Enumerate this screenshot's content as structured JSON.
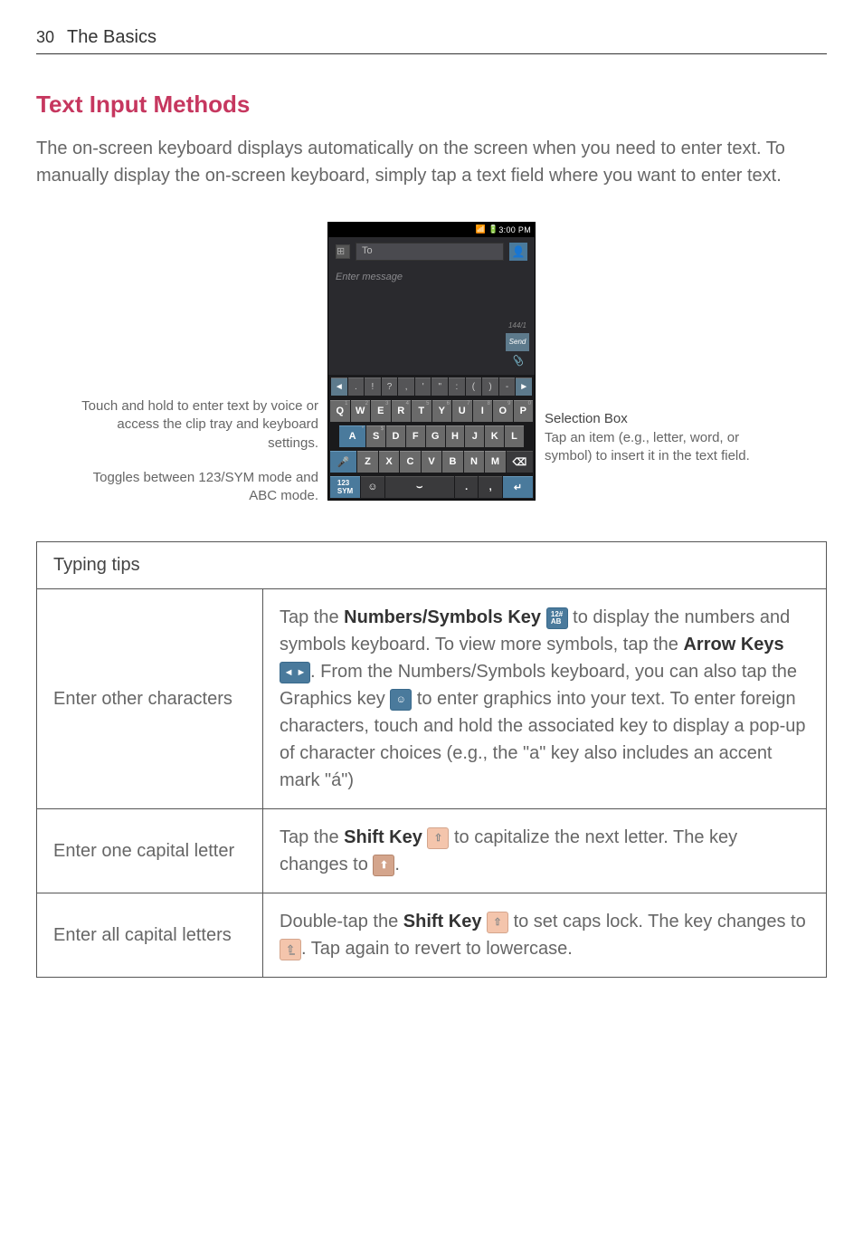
{
  "header": {
    "page_num": "30",
    "section": "The Basics"
  },
  "heading": "Text Input Methods",
  "intro": "The on-screen keyboard displays automatically on the screen when you need to enter text. To manually display the on-screen keyboard, simply tap a text field where you want to enter text.",
  "left_annotations": {
    "anno1": "Touch and hold to enter text by voice or access the clip tray and keyboard settings.",
    "anno2": "Toggles between 123/SYM mode and ABC mode."
  },
  "right_annotations": {
    "title": "Selection Box",
    "desc": "Tap an item (e.g., letter, word, or symbol) to insert it in the text field."
  },
  "phone": {
    "status_time": "3:00 PM",
    "to_label": "To",
    "msg_placeholder": "Enter message",
    "count_label": "144/1",
    "send_label": "Send",
    "selection_keys": [
      "◄",
      ".",
      "!",
      "?",
      ",",
      "'",
      "\"",
      ":",
      "(",
      ")",
      "-",
      "►"
    ],
    "row1": [
      {
        "l": "Q",
        "s": "1"
      },
      {
        "l": "W",
        "s": "2"
      },
      {
        "l": "E",
        "s": "3"
      },
      {
        "l": "R",
        "s": "4"
      },
      {
        "l": "T",
        "s": "5"
      },
      {
        "l": "Y",
        "s": "6"
      },
      {
        "l": "U",
        "s": "7"
      },
      {
        "l": "I",
        "s": "8"
      },
      {
        "l": "O",
        "s": "9"
      },
      {
        "l": "P",
        "s": "0"
      }
    ],
    "row2": [
      {
        "l": "A",
        "s": "*"
      },
      {
        "l": "S",
        "s": "$"
      },
      {
        "l": "D",
        "s": ""
      },
      {
        "l": "F",
        "s": ""
      },
      {
        "l": "G",
        "s": ""
      },
      {
        "l": "H",
        "s": ""
      },
      {
        "l": "J",
        "s": ""
      },
      {
        "l": "K",
        "s": ""
      },
      {
        "l": "L",
        "s": ""
      }
    ],
    "row3": [
      {
        "l": "Z",
        "s": ""
      },
      {
        "l": "X",
        "s": ""
      },
      {
        "l": "C",
        "s": ""
      },
      {
        "l": "V",
        "s": ""
      },
      {
        "l": "B",
        "s": ""
      },
      {
        "l": "N",
        "s": ""
      },
      {
        "l": "M",
        "s": ""
      }
    ]
  },
  "table": {
    "header": "Typing tips",
    "rows": {
      "r1": {
        "label": "Enter other characters",
        "p1a": "Tap the ",
        "p1b": "Numbers/Symbols Key",
        "p1c": " to display the numbers and symbols keyboard. To view more symbols, tap the ",
        "p1d": "Arrow Keys",
        "p1e": ". From the Numbers/Symbols keyboard, you can also tap the Graphics key ",
        "p1f": " to enter graphics into your text. To enter foreign characters, touch and hold the associated key to display a pop-up of character choices (e.g., the \"a\" key also includes an accent mark \"á\")"
      },
      "r2": {
        "label": "Enter one capital letter",
        "p2a": "Tap the ",
        "p2b": "Shift Key",
        "p2c": " to capitalize the next letter. The key changes to ",
        "p2d": "."
      },
      "r3": {
        "label": "Enter all capital letters",
        "p3a": "Double-tap the ",
        "p3b": "Shift Key",
        "p3c": " to set caps lock. The key changes to ",
        "p3d": ". Tap again to revert to lowercase."
      }
    }
  }
}
